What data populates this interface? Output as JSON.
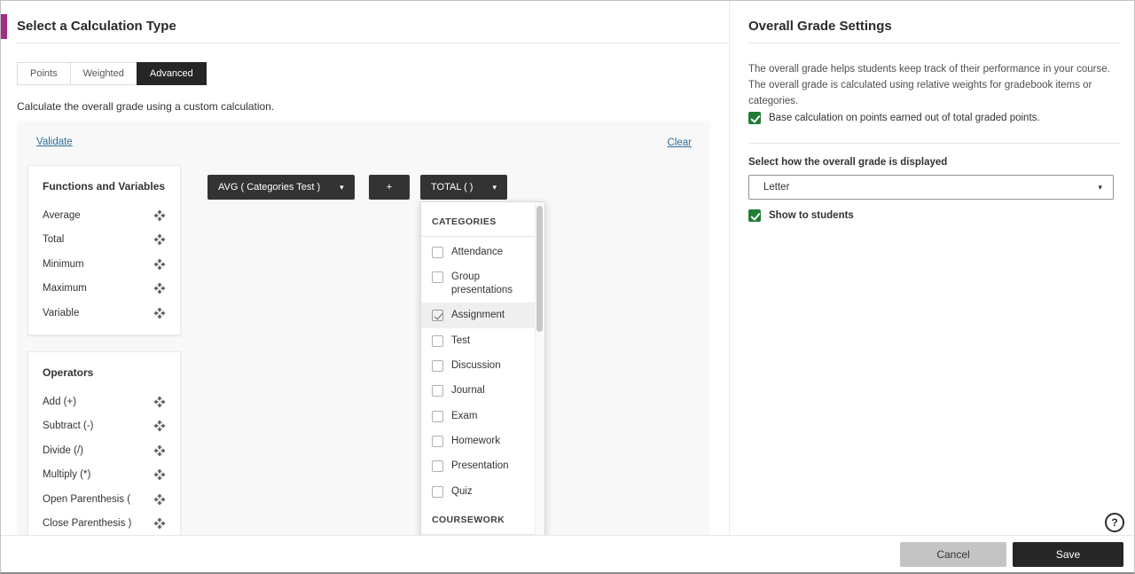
{
  "colors": {
    "accent": "#a32c86",
    "link": "#2f6e9b",
    "chip": "#333333",
    "green": "#217d35",
    "dark": "#262626"
  },
  "icons": {
    "caret": "▾",
    "help": "?"
  },
  "left": {
    "title": "Select a Calculation Type",
    "tabs": [
      {
        "label": "Points",
        "active": false
      },
      {
        "label": "Weighted",
        "active": false
      },
      {
        "label": "Advanced",
        "active": true
      }
    ],
    "description": "Calculate the overall grade using a custom calculation.",
    "validate": "Validate",
    "clear": "Clear",
    "functions": {
      "title": "Functions and Variables",
      "items": [
        "Average",
        "Total",
        "Minimum",
        "Maximum",
        "Variable"
      ]
    },
    "operators": {
      "title": "Operators",
      "items": [
        "Add (+)",
        "Subtract (-)",
        "Divide (/)",
        "Multiply (*)",
        "Open Parenthesis (",
        "Close Parenthesis )"
      ]
    },
    "formula": {
      "chips": [
        {
          "label": "AVG ( Categories Test )"
        },
        {
          "label": "+"
        },
        {
          "label": "TOTAL ( )"
        }
      ]
    },
    "dropdown": {
      "section1": "CATEGORIES",
      "items": [
        {
          "label": "Attendance",
          "checked": false
        },
        {
          "label": "Group presentations",
          "checked": false
        },
        {
          "label": "Assignment",
          "checked": true
        },
        {
          "label": "Test",
          "checked": false
        },
        {
          "label": "Discussion",
          "checked": false
        },
        {
          "label": "Journal",
          "checked": false
        },
        {
          "label": "Exam",
          "checked": false
        },
        {
          "label": "Homework",
          "checked": false
        },
        {
          "label": "Presentation",
          "checked": false
        },
        {
          "label": "Quiz",
          "checked": false
        }
      ],
      "section2": "COURSEWORK"
    }
  },
  "right": {
    "title": "Overall Grade Settings",
    "description": "The overall grade helps students keep track of their performance in your course. The overall grade is calculated using relative weights for gradebook items or categories.",
    "base_points": {
      "label": "Base calculation on points earned out of total graded points.",
      "checked": true
    },
    "display_label": "Select how the overall grade is displayed",
    "display_value": "Letter",
    "show_students": {
      "label": "Show to students",
      "checked": true
    }
  },
  "footer": {
    "cancel": "Cancel",
    "save": "Save"
  }
}
